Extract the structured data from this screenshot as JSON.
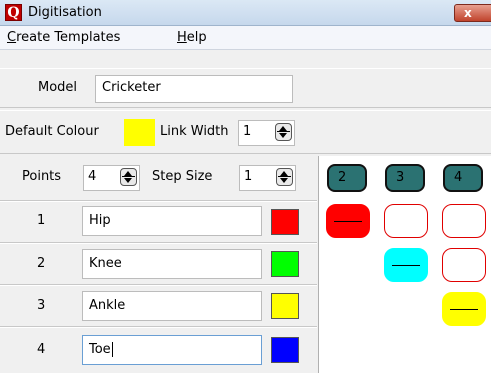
{
  "window": {
    "title": "Digitisation",
    "app_icon_letter": "Q",
    "close_glyph": "x"
  },
  "menu": [
    {
      "accel": "C",
      "rest": "reate Templates"
    },
    {
      "accel": "H",
      "rest": "elp"
    }
  ],
  "model": {
    "label": "Model",
    "value": "Cricketer"
  },
  "defaults": {
    "colour_label": "Default Colour",
    "colour": "#ffff00",
    "link_width_label": "Link Width",
    "link_width": "1"
  },
  "points_bar": {
    "points_label": "Points",
    "points": "4",
    "step_label": "Step Size",
    "step": "1"
  },
  "points": [
    {
      "index": "1",
      "name": "Hip",
      "color": "#ff0000"
    },
    {
      "index": "2",
      "name": "Knee",
      "color": "#00ff00"
    },
    {
      "index": "3",
      "name": "Ankle",
      "color": "#ffff00"
    },
    {
      "index": "4",
      "name": "Toe",
      "color": "#0000ff"
    }
  ],
  "matrix": {
    "headers": [
      "2",
      "3",
      "4"
    ],
    "header_color": "#2b7272",
    "cells": [
      [
        {
          "fill": "#ff0000",
          "link": true
        },
        {
          "fill": "#ffffff",
          "link": false
        },
        {
          "fill": "#ffffff",
          "link": false
        }
      ],
      [
        null,
        {
          "fill": "#00ffff",
          "link": true
        },
        {
          "fill": "#ffffff",
          "link": false
        }
      ],
      [
        null,
        null,
        {
          "fill": "#ffff00",
          "link": true
        }
      ]
    ]
  }
}
